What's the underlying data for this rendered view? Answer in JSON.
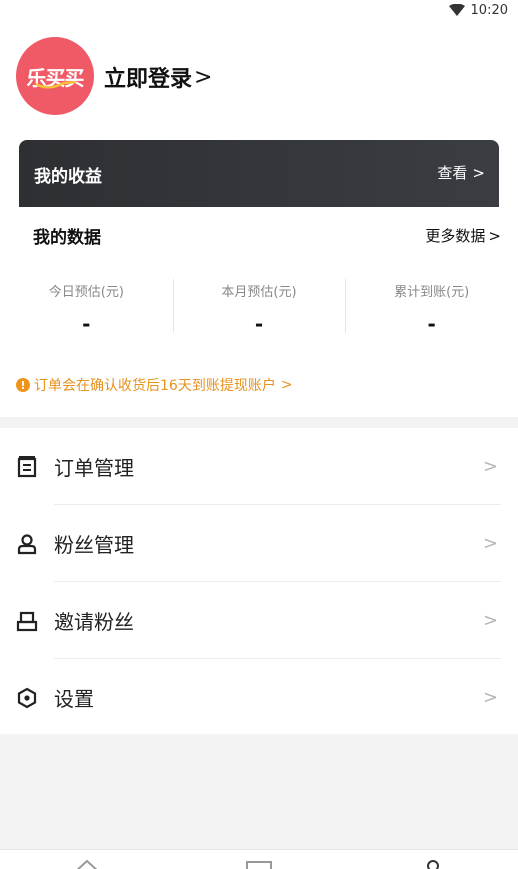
{
  "status_bar": {
    "time": "10:20",
    "wifi_icon": "wifi-icon"
  },
  "profile": {
    "avatar_logo": "乐买买",
    "login_label": "立即登录",
    "login_chevron": ">"
  },
  "earnings": {
    "title": "我的收益",
    "view_label": "查看",
    "view_chevron": ">"
  },
  "my_data": {
    "title": "我的数据",
    "more_label": "更多数据",
    "more_chevron": ">",
    "stats": [
      {
        "label": "今日预估(元)",
        "value": "-"
      },
      {
        "label": "本月预估(元)",
        "value": "-"
      },
      {
        "label": "累计到账(元)",
        "value": "-"
      }
    ],
    "notice": "订单会在确认收货后16天到账提现账户",
    "notice_chevron": ">",
    "notice_icon": "!"
  },
  "menu": {
    "items": [
      {
        "label": "订单管理",
        "icon": "order-list-icon",
        "chevron": ">"
      },
      {
        "label": "粉丝管理",
        "icon": "user-icon",
        "chevron": ">"
      },
      {
        "label": "邀请粉丝",
        "icon": "invite-icon",
        "chevron": ">"
      },
      {
        "label": "设置",
        "icon": "settings-icon",
        "chevron": ">"
      }
    ]
  },
  "colors": {
    "avatar_bg": "#f05a66",
    "card_bg": "#2d2f33",
    "notice": "#e69320",
    "page_bg": "#f3f3f3"
  }
}
